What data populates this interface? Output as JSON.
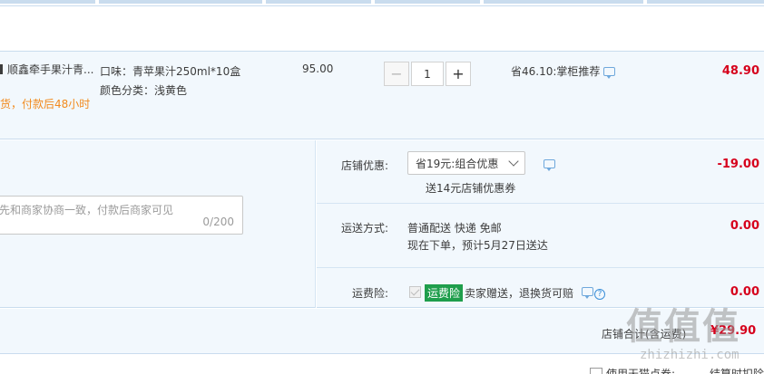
{
  "product": {
    "title": "顺鑫牵手果汁青...",
    "shipping_note": "货，付款后48小时",
    "sku_line1": "口味：青苹果汁250ml*10盒",
    "sku_line2": "颜色分类：浅黄色",
    "unit_price": "95.00",
    "quantity": "1",
    "minus_label": "−",
    "plus_label": "+",
    "savings_text": "省46.10:掌柜推荐",
    "line_total": "48.90"
  },
  "message": {
    "placeholder": "先和商家协商一致，付款后商家可见",
    "char_count": "0/200"
  },
  "store_discount": {
    "label": "店铺优惠:",
    "selected": "省19元:组合优惠",
    "note": "送14元店铺优惠券",
    "amount": "-19.00"
  },
  "shipping": {
    "label": "运送方式:",
    "method": "普通配送 快递 免邮",
    "eta": "现在下单，预计5月27日送达",
    "amount": "0.00"
  },
  "insurance": {
    "label": "运费险:",
    "badge": "运费险",
    "text": "卖家赠送，退换货可赔",
    "help": "?",
    "amount": "0.00"
  },
  "store_total": {
    "label": "店铺合计(含运费)",
    "value": "¥29.90"
  },
  "bottom": {
    "text1": "使用天猫点券:",
    "text2": "结算时扣除"
  },
  "watermark": {
    "text": "值值值",
    "domain": "zhizhizhi.com"
  }
}
